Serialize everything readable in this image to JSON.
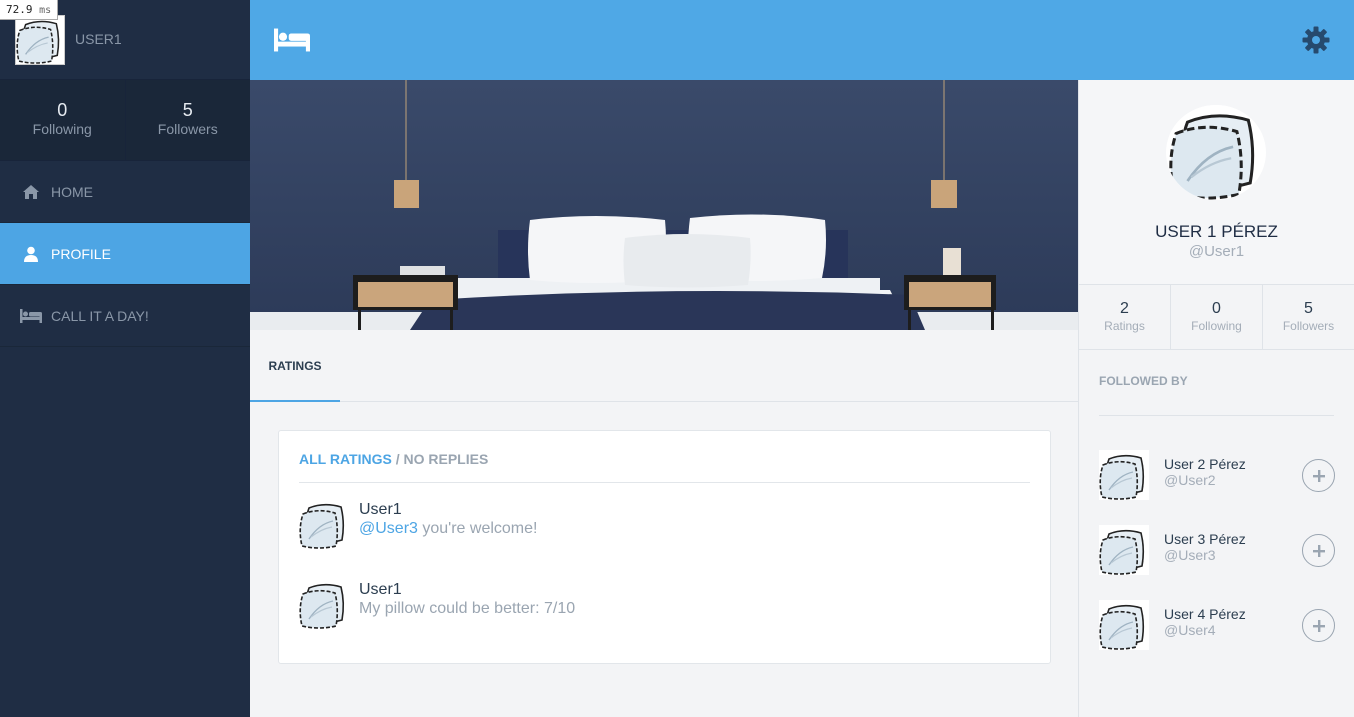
{
  "perf": {
    "value": "72.9",
    "unit": "ms"
  },
  "sidebar": {
    "username": "USER1",
    "stats": [
      {
        "value": "0",
        "label": "Following"
      },
      {
        "value": "5",
        "label": "Followers"
      }
    ],
    "nav": [
      {
        "label": "HOME",
        "icon": "home-icon"
      },
      {
        "label": "PROFILE",
        "icon": "user-icon",
        "active": true
      },
      {
        "label": "CALL IT A DAY!",
        "icon": "bed-icon"
      }
    ]
  },
  "header": {
    "logo_icon": "bed-icon",
    "settings_icon": "gear-icon",
    "color": "#4fa8e6"
  },
  "tabs": [
    {
      "label": "RATINGS",
      "active": true
    }
  ],
  "ratings": {
    "filter": {
      "all": "ALL RATINGS",
      "separator": " / ",
      "no_replies": "NO REPLIES"
    },
    "posts": [
      {
        "author": "User1",
        "mention": "@User3",
        "text": " you're welcome!"
      },
      {
        "author": "User1",
        "mention": "",
        "text": "My pillow could be better: 7/10"
      }
    ]
  },
  "profile": {
    "full_name": "USER 1 PÉREZ",
    "handle": "@User1",
    "stats": [
      {
        "value": "2",
        "label": "Ratings"
      },
      {
        "value": "0",
        "label": "Following"
      },
      {
        "value": "5",
        "label": "Followers"
      }
    ],
    "followed_by_title": "FOLLOWED BY",
    "followers": [
      {
        "name": "User 2 Pérez",
        "handle": "@User2"
      },
      {
        "name": "User 3 Pérez",
        "handle": "@User3"
      },
      {
        "name": "User 4 Pérez",
        "handle": "@User4"
      }
    ]
  },
  "colors": {
    "sidebar": "#1f2d44",
    "accent": "#4da5e4",
    "text_muted": "#9aa5b1"
  }
}
